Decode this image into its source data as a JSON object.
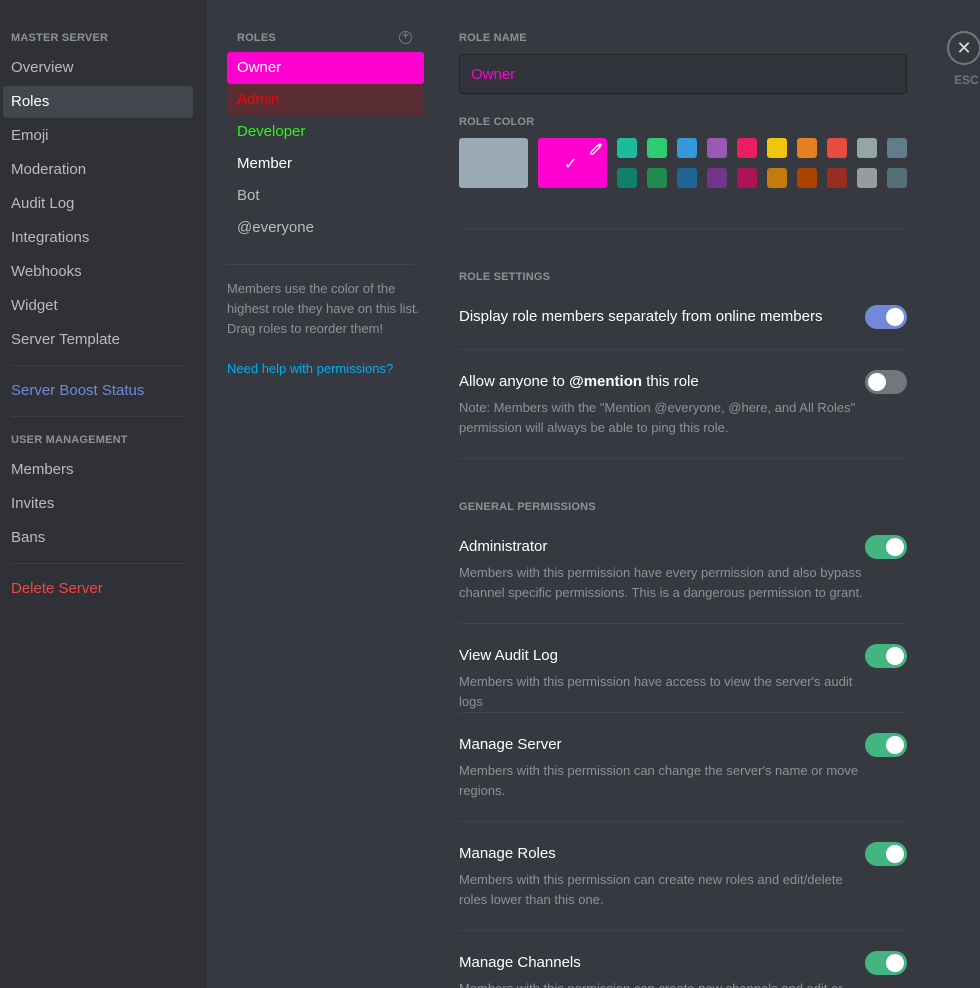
{
  "sidebar": {
    "server_header": "MASTER SERVER",
    "items": [
      {
        "label": "Overview"
      },
      {
        "label": "Roles"
      },
      {
        "label": "Emoji"
      },
      {
        "label": "Moderation"
      },
      {
        "label": "Audit Log"
      },
      {
        "label": "Integrations"
      },
      {
        "label": "Webhooks"
      },
      {
        "label": "Widget"
      },
      {
        "label": "Server Template"
      }
    ],
    "boost_label": "Server Boost Status",
    "user_mgmt_header": "USER MANAGEMENT",
    "user_items": [
      {
        "label": "Members"
      },
      {
        "label": "Invites"
      },
      {
        "label": "Bans"
      }
    ],
    "delete_label": "Delete Server",
    "active_item": "Roles"
  },
  "roles": {
    "header": "ROLES",
    "list": [
      {
        "name": "Owner",
        "color": "#ffffff",
        "bg": "#ff00d1"
      },
      {
        "name": "Admin",
        "color": "#ff0000",
        "bg": "#5a2d33"
      },
      {
        "name": "Developer",
        "color": "#2cf41c",
        "bg": ""
      },
      {
        "name": "Member",
        "color": "#ffffff",
        "bg": ""
      },
      {
        "name": "Bot",
        "color": "#b9bbbe",
        "bg": ""
      },
      {
        "name": "@everyone",
        "color": "#b9bbbe",
        "bg": ""
      }
    ],
    "help_text": "Members use the color of the highest role they have on this list. Drag roles to reorder them!",
    "permissions_link": "Need help with permissions?"
  },
  "main": {
    "role_name_label": "ROLE NAME",
    "role_name_value": "Owner",
    "role_color_label": "ROLE COLOR",
    "default_color": "#99aab5",
    "selected_color": "#ff00d1",
    "swatches_top": [
      "#1abc9c",
      "#2ecc71",
      "#3498db",
      "#9b59b6",
      "#e91e63",
      "#f1c40f",
      "#e67e22",
      "#e74c3c",
      "#95a5a6",
      "#607d8b"
    ],
    "swatches_bottom": [
      "#11806a",
      "#1f8b4c",
      "#206694",
      "#71368a",
      "#ad1457",
      "#c27c0e",
      "#a84300",
      "#992d22",
      "#979c9f",
      "#546e7a"
    ],
    "role_settings_label": "ROLE SETTINGS",
    "display_separately": {
      "title": "Display role members separately from online members",
      "enabled": true
    },
    "mention": {
      "title_pre": "Allow anyone to ",
      "title_bold": "@mention",
      "title_post": " this role",
      "desc": "Note: Members with the \"Mention @everyone, @here, and All Roles\" permission will always be able to ping this role.",
      "enabled": false
    },
    "general_label": "GENERAL PERMISSIONS",
    "permissions": [
      {
        "title": "Administrator",
        "desc": "Members with this permission have every permission and also bypass channel specific permissions. This is a dangerous permission to grant.",
        "enabled": true
      },
      {
        "title": "View Audit Log",
        "desc": "Members with this permission have access to view the server's audit logs",
        "enabled": true
      },
      {
        "title": "Manage Server",
        "desc": "Members with this permission can change the server's name or move regions.",
        "enabled": true
      },
      {
        "title": "Manage Roles",
        "desc": "Members with this permission can create new roles and edit/delete roles lower than this one.",
        "enabled": true
      },
      {
        "title": "Manage Channels",
        "desc": "Members with this permission can create new channels and edit or delete existing ones.",
        "enabled": true
      }
    ]
  },
  "close": {
    "esc_label": "ESC",
    "icon": "close-icon"
  }
}
